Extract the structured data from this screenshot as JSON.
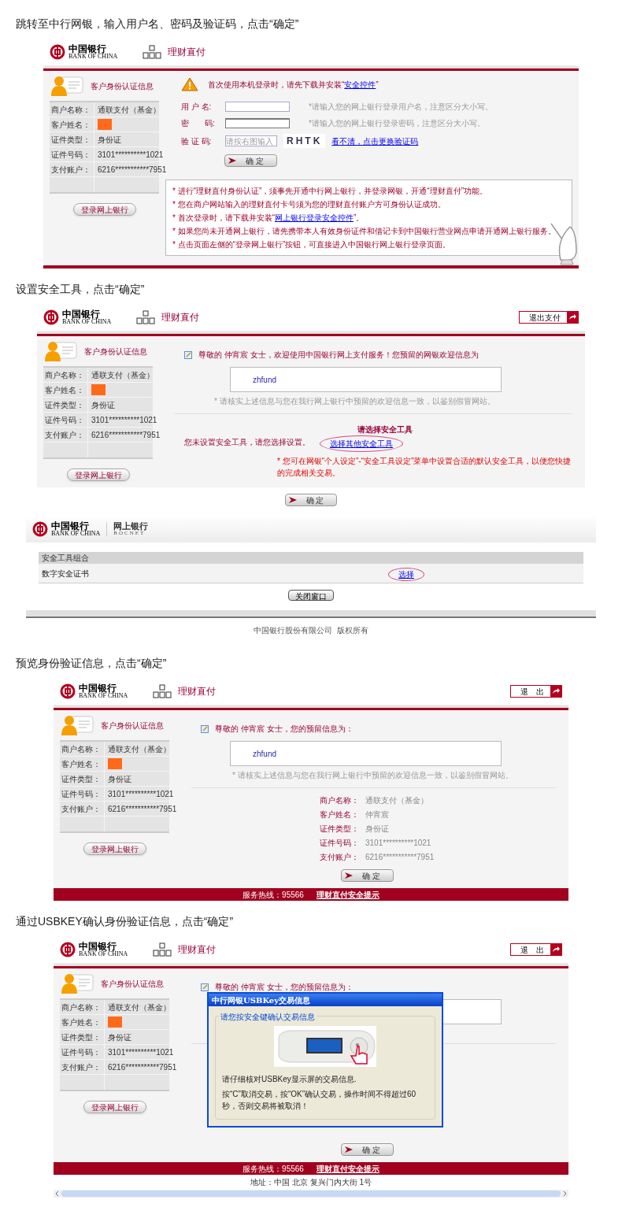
{
  "steps": [
    {
      "caption": "跳转至中行网银，输入用户名、密码及验证码，点击“确定”",
      "screen": {
        "kind": "login",
        "logo": {
          "name": "中国银行",
          "english": "BANK OF CHINA"
        },
        "title": "理财直付",
        "sidebar": {
          "heading": "客户身份认证信息",
          "rows": [
            {
              "label": "商户名称：",
              "kind": "text",
              "value": "通联支付（基金）"
            },
            {
              "label": "客户姓名：",
              "kind": "redacted"
            },
            {
              "label": "证件类型：",
              "kind": "text",
              "value": "身份证"
            },
            {
              "label": "证件号码：",
              "kind": "text",
              "value": "3101**********1021"
            },
            {
              "label": "支付账户：",
              "kind": "text",
              "value": "6216***********7951"
            }
          ],
          "login_button": "登录网上银行"
        },
        "warning": {
          "before": "首次使用本机登录时，请先下载并安装“",
          "link": "安全控件",
          "after": "”"
        },
        "fields": [
          {
            "kind": "text",
            "label": "用 户 名:",
            "hint": "*请输入您的网上银行登录用户名，注意区分大小写。"
          },
          {
            "kind": "password",
            "label": "密　　码:",
            "hint": "*请输入您的网上银行登录密码，注意区分大小写。"
          },
          {
            "kind": "captcha",
            "label": "验 证 码:",
            "placeholder": "请按右图输入",
            "captcha": "RHTK",
            "link": "看不清，点击更换验证码"
          }
        ],
        "confirm": "确 定",
        "notes": [
          {
            "text": "* 进行“理财直付身份认证”，须事先开通中行网上银行，并登录网银，开通“理财直付”功能。"
          },
          {
            "text": "* 您在商户网站输入的理财直付卡号须为您的理财直付账户方可身份认证成功。"
          },
          {
            "text": "* 首次登录时，请下载并安装“",
            "link": "网上银行登录安全控件",
            "after": "”。"
          },
          {
            "text": "* 如果您尚未开通网上银行，请先携带本人有效身份证件和借记卡到中国银行营业网点申请开通网上银行服务。"
          },
          {
            "text": "* 点击页面左侧的“登录网上银行”按钮，可直接进入中国银行网上银行登录页面。"
          }
        ]
      }
    },
    {
      "caption": "设置安全工具，点击“确定”",
      "screen": {
        "kind": "security",
        "logo": {
          "name": "中国银行",
          "english": "BANK OF CHINA"
        },
        "title": "理财直付",
        "exit": "退出支付",
        "sidebar": {
          "heading": "客户身份认证信息",
          "rows": [
            {
              "label": "商户名称：",
              "kind": "text",
              "value": "通联支付（基金）"
            },
            {
              "label": "客户姓名：",
              "kind": "redacted"
            },
            {
              "label": "证件类型：",
              "kind": "text",
              "value": "身份证"
            },
            {
              "label": "证件号码：",
              "kind": "text",
              "value": "3101**********1021"
            },
            {
              "label": "支付账户：",
              "kind": "text",
              "value": "6216***********7951"
            }
          ],
          "login_button": "登录网上银行"
        },
        "greeting": "尊敬的 仲宵宸 女士，欢迎使用中国银行网上支付服务！您预留的网银欢迎信息为",
        "welcome": "zhfund",
        "verify_note": "* 请核实上述信息与您在我行网上银行中预留的欢迎信息一致，以鉴别假冒网站。",
        "tool_prompt": "您未设置安全工具，请您选择设置。",
        "tool_heading": "请选择安全工具",
        "tool_link": {
          "text": "选择其他安全工具",
          "circled": true
        },
        "tool_note": "* 您可在网银“个人设定”-“安全工具设定”菜单中设置合适的默认安全工具，以便您快捷的完成相关交易。"
      },
      "after_button": "确 定"
    },
    {
      "screen": {
        "kind": "bocnet",
        "logo": {
          "name": "中国银行",
          "english": "BANK OF CHINA"
        },
        "title": "网上银行",
        "subtitle": "BOCNET",
        "table_heading": "安全工具组合",
        "tool": "数字安全证书",
        "choose": {
          "text": "选择",
          "circled": true
        },
        "close": "关闭窗口",
        "copyright": "中国银行股份有限公司  版权所有"
      }
    },
    {
      "caption": "预览身份验证信息，点击“确定”",
      "screen": {
        "kind": "preview",
        "logo": {
          "name": "中国银行",
          "english": "BANK OF CHINA"
        },
        "title": "理财直付",
        "exit": "退　出",
        "sidebar": {
          "heading": "客户身份认证信息",
          "rows": [
            {
              "label": "商户名称：",
              "kind": "text",
              "value": "通联支付（基金）"
            },
            {
              "label": "客户姓名：",
              "kind": "redacted"
            },
            {
              "label": "证件类型：",
              "kind": "text",
              "value": "身份证"
            },
            {
              "label": "证件号码：",
              "kind": "text",
              "value": "3101**********1021"
            },
            {
              "label": "支付账户：",
              "kind": "text",
              "value": "6216***********7951"
            }
          ],
          "login_button": "登录网上银行"
        },
        "greeting": "尊敬的 仲宵宸 女士，您的预留信息为：",
        "welcome": "zhfund",
        "verify_note": "* 请核实上述信息与您在我行网上银行中预留的欢迎信息一致，以鉴别假冒网站。",
        "details": [
          {
            "label": "商户名称：",
            "value": "通联支付（基金）"
          },
          {
            "label": "客户姓名：",
            "value": "仲宵宸"
          },
          {
            "label": "证件类型：",
            "value": "身份证"
          },
          {
            "label": "证件号码：",
            "value": "3101**********1021"
          },
          {
            "label": "支付账户：",
            "value": "6216***********7951"
          }
        ],
        "confirm": "确 定",
        "footer": {
          "hotline": "服务热线：95566",
          "link": "理财直付安全提示"
        }
      }
    },
    {
      "caption": "通过USBKEY确认身份验证信息，点击“确定”",
      "screen": {
        "kind": "usbkey",
        "logo": {
          "name": "中国银行",
          "english": "BANK OF CHINA"
        },
        "title": "理财直付",
        "exit": "退　出",
        "sidebar": {
          "heading": "客户身份认证信息",
          "rows": [
            {
              "label": "商户名称：",
              "kind": "text",
              "value": "通联支付（基金）"
            },
            {
              "label": "客户姓名：",
              "kind": "redacted"
            },
            {
              "label": "证件类型：",
              "kind": "text",
              "value": "身份证"
            },
            {
              "label": "证件号码：",
              "kind": "text",
              "value": "3101**********1021"
            },
            {
              "label": "支付账户：",
              "kind": "text",
              "value": "6216***********7951"
            }
          ],
          "login_button": "登录网上银行"
        },
        "greeting": "尊敬的 仲宵宸 女士，您的预留信息为：",
        "dialog": {
          "title": "中行网银USBKey交易信息",
          "group": "请您按安全键确认交易信息",
          "lines": [
            "请仔细核对USBKey显示屏的交易信息.",
            "按“C”取消交易，按“OK”确认交易，操作时间不得超过60秒，否则交易将被取消！"
          ]
        },
        "confirm": "确 定",
        "footer": {
          "hotline": "服务热线：95566",
          "link": "理财直付安全提示"
        },
        "address": "地址：中国  北京  复兴门内大街  1号"
      }
    }
  ]
}
